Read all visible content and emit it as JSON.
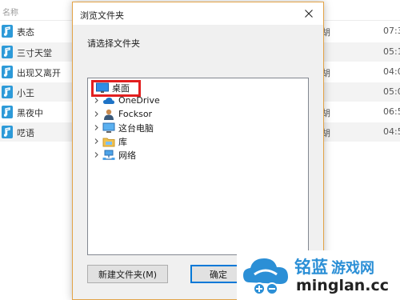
{
  "background": {
    "header_name": "名称",
    "rows": [
      {
        "title": "表态",
        "extra": "胡",
        "time": "07:3"
      },
      {
        "title": "三寸天堂",
        "extra": "",
        "time": "05:1"
      },
      {
        "title": "出现又离开",
        "extra": "胡",
        "time": "04:0"
      },
      {
        "title": "小王",
        "extra": "",
        "time": "05:0"
      },
      {
        "title": "黑夜中",
        "extra": "胡",
        "time": "06:5"
      },
      {
        "title": "呓语",
        "extra": "胡",
        "time": "04:5"
      }
    ]
  },
  "dialog": {
    "title": "浏览文件夹",
    "instruction": "请选择文件夹",
    "tree": [
      {
        "label": "桌面",
        "icon": "desktop-icon",
        "expandable": false
      },
      {
        "label": "OneDrive",
        "icon": "cloud-icon",
        "expandable": true
      },
      {
        "label": "Focksor",
        "icon": "user-icon",
        "expandable": true
      },
      {
        "label": "这台电脑",
        "icon": "computer-icon",
        "expandable": true
      },
      {
        "label": "库",
        "icon": "library-icon",
        "expandable": true
      },
      {
        "label": "网络",
        "icon": "network-icon",
        "expandable": true
      }
    ],
    "new_folder_label": "新建文件夹(M)",
    "ok_label": "确定"
  },
  "watermark": {
    "brand": "铭蓝",
    "subtitle": "游戏网",
    "domain": "minglan.cc"
  },
  "colors": {
    "dialog_border": "#e3a347",
    "highlight": "#e21f1f",
    "accent": "#0078d7",
    "watermark_blue": "#2b8fd6"
  }
}
